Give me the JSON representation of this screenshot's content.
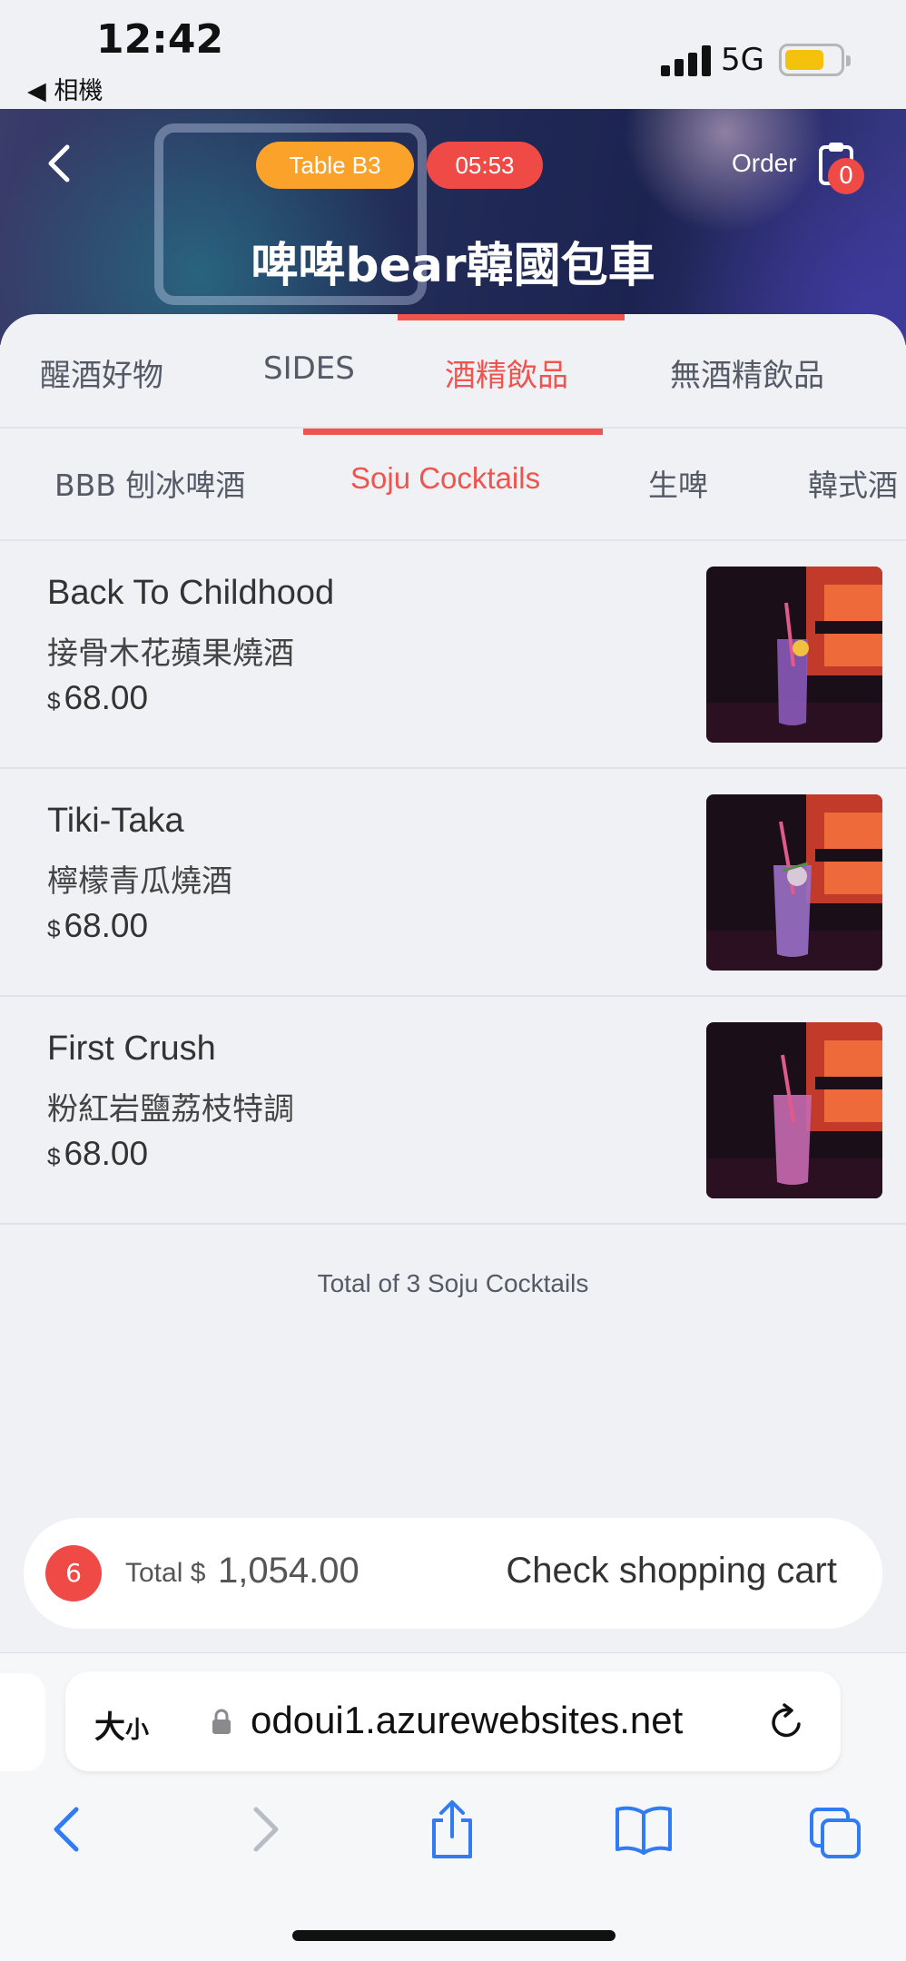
{
  "status_bar": {
    "time": "12:42",
    "back_label": "◀ 相機",
    "network": "5G",
    "battery_color": "#f4c20d"
  },
  "header": {
    "table": "Table  B3",
    "timer": "05:53",
    "order_label": "Order",
    "order_count": "0",
    "store_name": "啤啤bear韓國包車",
    "accent_color": "#f0544e"
  },
  "category_tabs": [
    {
      "label": "醒酒好物",
      "active": false
    },
    {
      "label": "SIDES",
      "active": false
    },
    {
      "label": "酒精飲品",
      "active": true
    },
    {
      "label": "無酒精飲品",
      "active": false
    }
  ],
  "sub_tabs": [
    {
      "label": "BBB 刨冰啤酒",
      "active": false
    },
    {
      "label": "Soju Cocktails",
      "active": true
    },
    {
      "label": "生啤",
      "active": false
    },
    {
      "label": "韓式酒",
      "active": false
    }
  ],
  "products": [
    {
      "name": "Back To Childhood",
      "subtitle": "接骨木花蘋果燒酒",
      "currency": "$",
      "price": "68.00",
      "image": "purple-cocktail-photo"
    },
    {
      "name": "Tiki-Taka",
      "subtitle": "檸檬青瓜燒酒",
      "currency": "$",
      "price": "68.00",
      "image": "purple-cocktail-photo"
    },
    {
      "name": "First Crush",
      "subtitle": "粉紅岩鹽荔枝特調",
      "currency": "$",
      "price": "68.00",
      "image": "pink-cocktail-photo"
    }
  ],
  "list_total": "Total of 3 Soju Cocktails",
  "cart": {
    "count": "6",
    "total_label": "Total $",
    "total_value": "1,054.00",
    "check_label": "Check shopping cart"
  },
  "browser": {
    "text_size_label_big": "大",
    "text_size_label_small": "小",
    "url": "odoui1.azurewebsites.net",
    "icons": [
      "back-arrow-icon",
      "forward-arrow-icon",
      "share-icon",
      "bookmarks-icon",
      "tabs-icon"
    ]
  }
}
